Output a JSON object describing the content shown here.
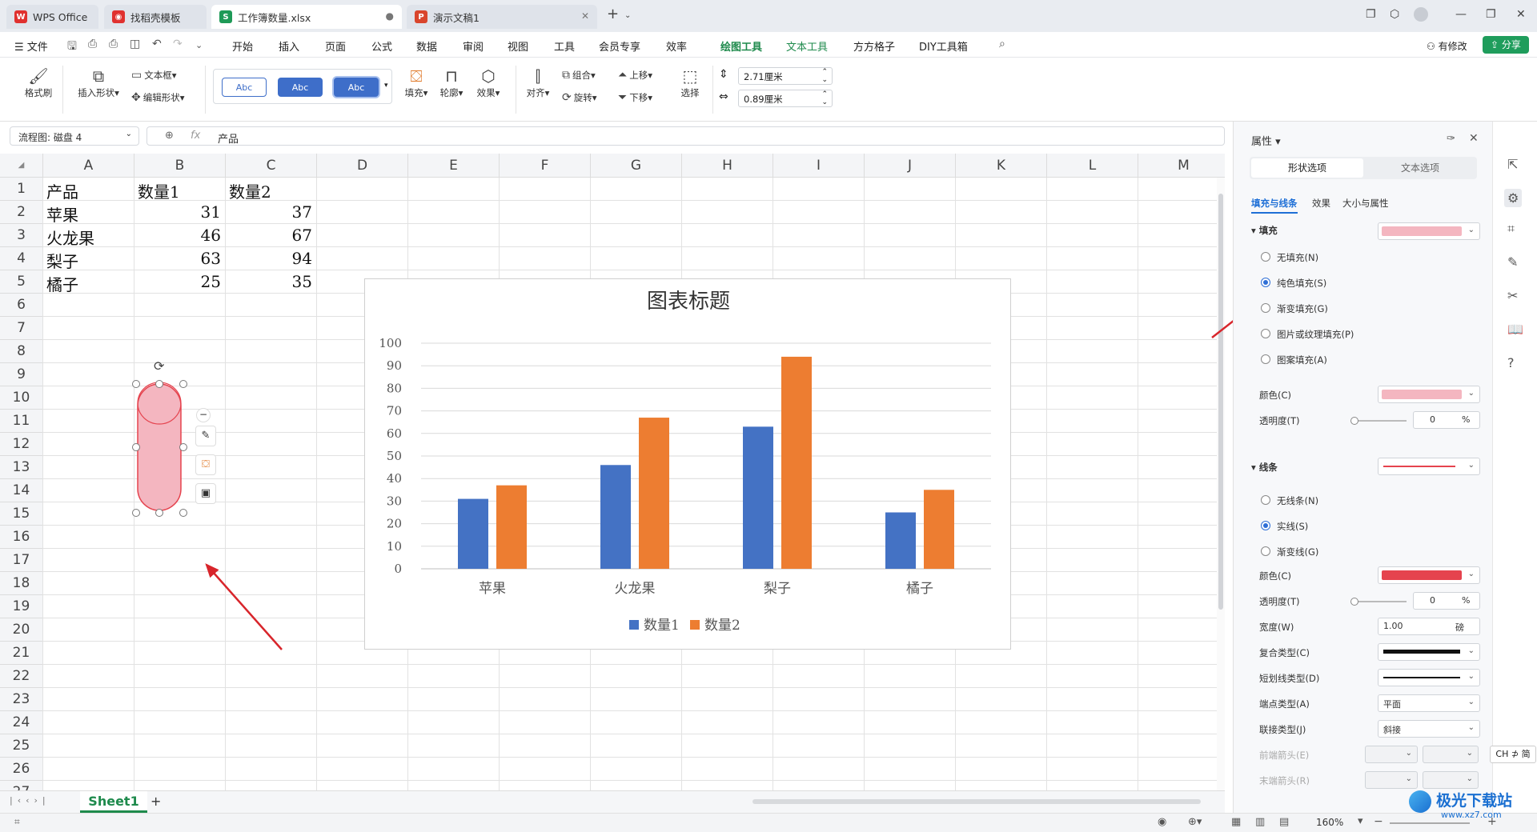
{
  "tabs": [
    {
      "label": "WPS Office"
    },
    {
      "label": "找稻壳模板"
    },
    {
      "label": "工作簿数量.xlsx"
    },
    {
      "label": "演示文稿1"
    }
  ],
  "menu": {
    "file": "文件",
    "items": [
      "开始",
      "插入",
      "页面",
      "公式",
      "数据",
      "审阅",
      "视图",
      "工具",
      "会员专享",
      "效率",
      "绘图工具",
      "文本工具",
      "方方格子",
      "DIY工具箱"
    ],
    "right": {
      "changes": "有修改",
      "share": "分享"
    }
  },
  "ribbon": {
    "format_brush": "格式刷",
    "insert_shape": "插入形状",
    "textbox": "文本框",
    "edit_shape": "编辑形状",
    "style_label": "Abc",
    "fill": "填充",
    "outline": "轮廓",
    "effect": "效果",
    "align": "对齐",
    "group": "组合",
    "rotate": "旋转",
    "bring_up": "上移",
    "send_down": "下移",
    "select": "选择",
    "height": "2.71厘米",
    "width": "0.89厘米"
  },
  "formula": {
    "name_box": "流程图: 磁盘 4",
    "fx": "fx",
    "content": "产品"
  },
  "grid": {
    "columns": [
      "A",
      "B",
      "C",
      "D",
      "E",
      "F",
      "G",
      "H",
      "I",
      "J",
      "K",
      "L",
      "M"
    ],
    "rows": [
      "1",
      "2",
      "3",
      "4",
      "5",
      "6",
      "7",
      "8",
      "9",
      "10",
      "11",
      "12",
      "13",
      "14",
      "15",
      "16",
      "17",
      "18",
      "19",
      "20",
      "21",
      "22",
      "23",
      "24",
      "25",
      "26",
      "27"
    ],
    "cells": [
      [
        "产品",
        "数量1",
        "数量2"
      ],
      [
        "苹果",
        "31",
        "37"
      ],
      [
        "火龙果",
        "46",
        "67"
      ],
      [
        "梨子",
        "63",
        "94"
      ],
      [
        "橘子",
        "25",
        "35"
      ]
    ]
  },
  "chart_data": {
    "type": "bar",
    "title": "图表标题",
    "categories": [
      "苹果",
      "火龙果",
      "梨子",
      "橘子"
    ],
    "series": [
      {
        "name": "数量1",
        "values": [
          31,
          46,
          63,
          25
        ],
        "color": "#4472c4"
      },
      {
        "name": "数量2",
        "values": [
          37,
          67,
          94,
          35
        ],
        "color": "#ed7d31"
      }
    ],
    "ylim": [
      0,
      100
    ],
    "yticks": [
      "0",
      "10",
      "20",
      "30",
      "40",
      "50",
      "60",
      "70",
      "80",
      "90",
      "100"
    ],
    "grid": true,
    "legend": "bottom"
  },
  "sheet": {
    "name": "Sheet1",
    "add": "+"
  },
  "status": {
    "zoom": "160%"
  },
  "panel": {
    "title": "属性",
    "tab_shape": "形状选项",
    "tab_text": "文本选项",
    "subtabs": [
      "填充与线条",
      "效果",
      "大小与属性"
    ],
    "fill_section": "填充",
    "fill_color": "#f4b6c0",
    "fill_options": [
      "无填充(N)",
      "纯色填充(S)",
      "渐变填充(G)",
      "图片或纹理填充(P)",
      "图案填充(A)"
    ],
    "color_label": "颜色(C)",
    "transparency_label": "透明度(T)",
    "transparency_value": "0",
    "percent": "%",
    "line_section": "线条",
    "line_color": "#e5434e",
    "line_options": [
      "无线条(N)",
      "实线(S)",
      "渐变线(G)"
    ],
    "width_label": "宽度(W)",
    "width_value": "1.00",
    "width_unit": "磅",
    "compound_label": "复合类型(C)",
    "dash_label": "短划线类型(D)",
    "cap_label": "端点类型(A)",
    "cap_value": "平面",
    "join_label": "联接类型(J)",
    "join_value": "斜接",
    "begin_arrow_label": "前端箭头(E)",
    "end_arrow_label": "末端箭头(R)"
  },
  "ime": "CH ⊅ 简",
  "watermark": {
    "text": "极光下载站",
    "url": "www.xz7.com"
  }
}
